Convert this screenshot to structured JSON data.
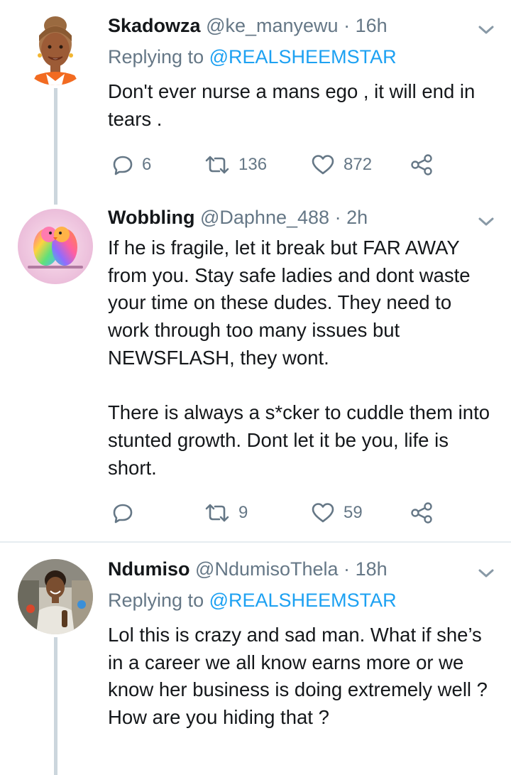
{
  "tweets": [
    {
      "name": "Skadowza",
      "handle": "@ke_manyewu",
      "time": "16h",
      "replying_prefix": "Replying to",
      "replying_to": "@REALSHEEMSTAR",
      "text": "Don't ever nurse a mans ego , it will end in tears .",
      "replies": "6",
      "retweets": "136",
      "likes": "872"
    },
    {
      "name": "Wobbling",
      "handle": "@Daphne_488",
      "time": "2h",
      "paragraphs": [
        "If he is fragile, let it break but FAR AWAY from you. Stay safe ladies and dont waste your time on these dudes. They need to work through too many issues but NEWSFLASH, they wont.",
        "There is always a s*cker to cuddle them into stunted growth. Dont let it be you, life is short."
      ],
      "replies": "",
      "retweets": "9",
      "likes": "59"
    },
    {
      "name": "Ndumiso",
      "handle": "@NdumisoThela",
      "time": "18h",
      "replying_prefix": "Replying to",
      "replying_to": "@REALSHEEMSTAR",
      "text": "Lol this is crazy and sad man. What if she’s in a career we all know earns more or we know her business is doing extremely well ? How are you hiding that ?"
    }
  ],
  "separator": "·",
  "colors": {
    "text": "#14171a",
    "secondary": "#657786",
    "link": "#1da1f2",
    "thread_line": "#ccd6dd",
    "divider": "#e6ecf0"
  },
  "icons": [
    "reply-icon",
    "retweet-icon",
    "like-icon",
    "share-icon",
    "chevron-down-icon"
  ]
}
